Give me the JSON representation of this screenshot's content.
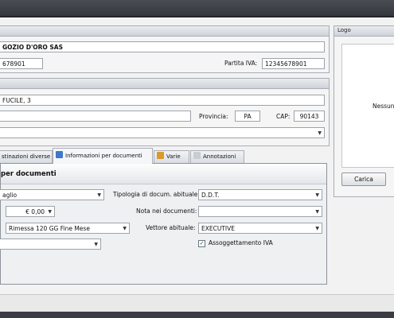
{
  "company": {
    "header": "",
    "name": "GOZIO D'ORO SAS",
    "tax_code": "678901",
    "vat_label": "Partita IVA:",
    "vat_value": "12345678901"
  },
  "address": {
    "header": "",
    "street": "FUCILE, 3",
    "city": "",
    "province_label": "Provincia:",
    "province_value": "PA",
    "cap_label": "CAP:",
    "cap_value": "90143",
    "country": ""
  },
  "logo": {
    "header": "Logo",
    "placeholder": "Nessun",
    "load_button": "Carica"
  },
  "tabs": [
    {
      "label": "stinazioni diverse"
    },
    {
      "label": "Informazioni per documenti"
    },
    {
      "label": "Varie"
    },
    {
      "label": "Annotazioni"
    }
  ],
  "documents": {
    "title": "per documenti",
    "payment": "aglio",
    "amount": "€ 0,00",
    "terms": "Rimessa 120 GG Fine Mese",
    "extra": "",
    "doc_type_label": "Tipologia di docum. abituale:",
    "doc_type_value": "D.D.T.",
    "note_label": "Nota nei documenti:",
    "note_value": "",
    "carrier_label": "Vettore abituale:",
    "carrier_value": "EXECUTIVE",
    "iva_label": "Assoggettamento IVA",
    "iva_checked": true
  },
  "icons": {
    "dropdown": "chevron-down-icon",
    "check": "checkmark-icon",
    "tab_docs": "document-icon",
    "tab_misc": "box-icon",
    "tab_notes": "pencil-icon"
  }
}
